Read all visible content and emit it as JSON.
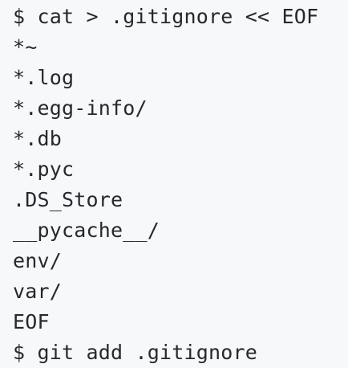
{
  "terminal": {
    "lines": [
      "$ cat > .gitignore << EOF",
      "*~",
      "*.log",
      "*.egg-info/",
      "*.db",
      "*.pyc",
      ".DS_Store",
      "__pycache__/",
      "env/",
      "var/",
      "EOF",
      "$ git add .gitignore"
    ]
  },
  "colors": {
    "background": "#f6f8fa",
    "text": "#24292e"
  }
}
